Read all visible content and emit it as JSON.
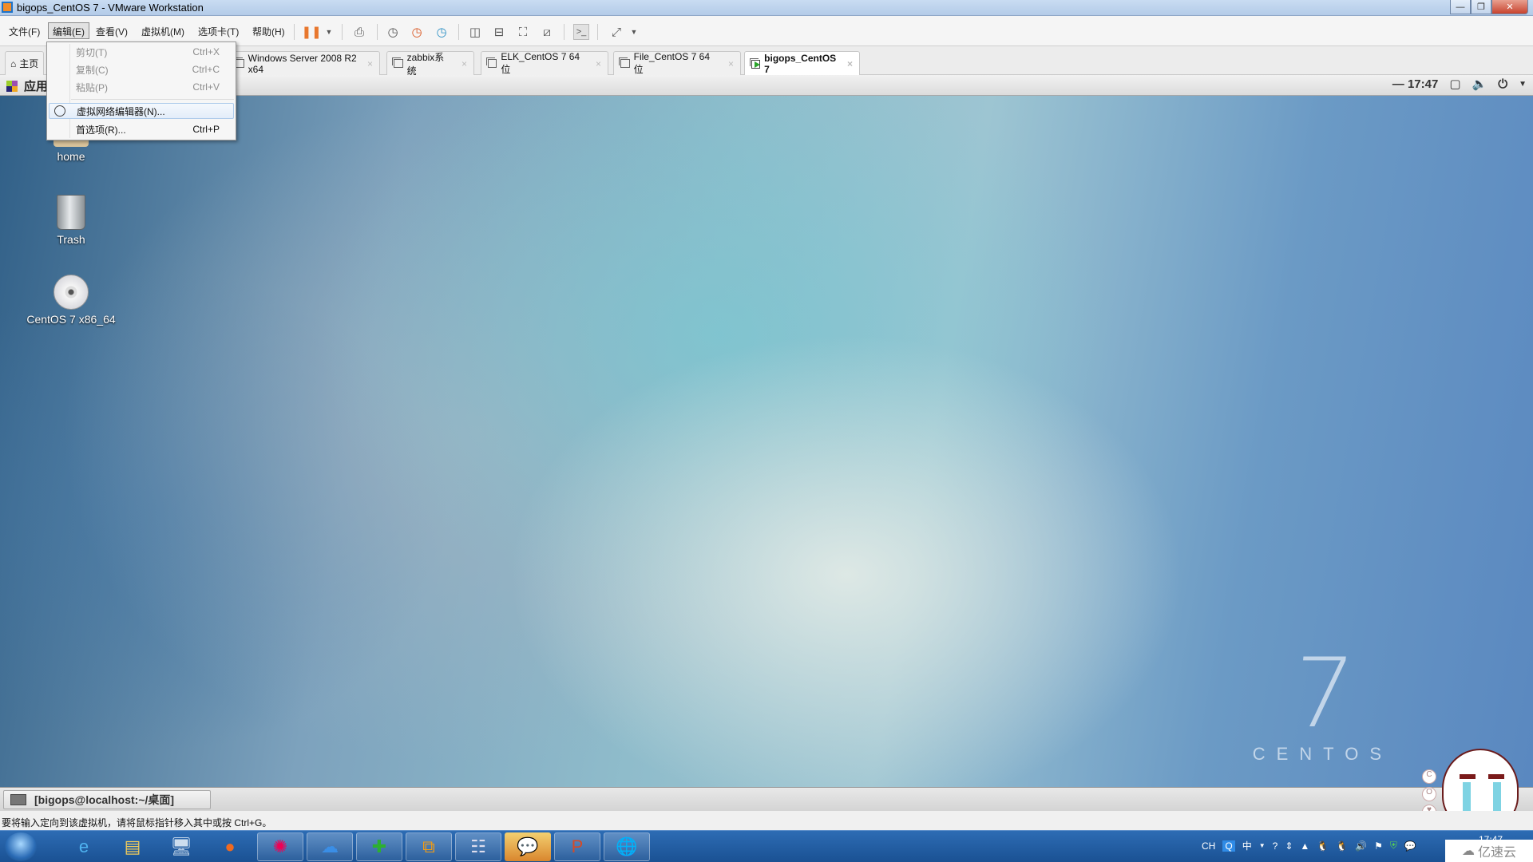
{
  "window": {
    "title": "bigops_CentOS 7 - VMware Workstation",
    "controls": {
      "minimize": "—",
      "restore": "❐",
      "close": "✕"
    }
  },
  "menubar": {
    "items": [
      {
        "label": "文件(F)"
      },
      {
        "label": "编辑(E)",
        "active": true
      },
      {
        "label": "查看(V)"
      },
      {
        "label": "虚拟机(M)"
      },
      {
        "label": "选项卡(T)"
      },
      {
        "label": "帮助(H)"
      }
    ],
    "toolbar_icons": [
      "pause-icon",
      "dropdown-icon",
      "send-ctrl-alt-del-icon",
      "snapshot-take-icon",
      "snapshot-revert-icon",
      "snapshot-manager-icon",
      "view-split-vertical-icon",
      "view-split-horizontal-icon",
      "fullscreen-icon",
      "unity-icon",
      "console-icon",
      "stretch-icon",
      "stretch-dropdown-icon"
    ]
  },
  "edit_menu": {
    "items": [
      {
        "label": "剪切(T)",
        "shortcut": "Ctrl+X",
        "disabled": true
      },
      {
        "label": "复制(C)",
        "shortcut": "Ctrl+C",
        "disabled": true
      },
      {
        "label": "粘贴(P)",
        "shortcut": "Ctrl+V",
        "disabled": true
      },
      {
        "label": "虚拟网络编辑器(N)...",
        "shortcut": "",
        "icon": "network-globe-icon",
        "highlighted": true
      },
      {
        "label": "首选项(R)...",
        "shortcut": "Ctrl+P"
      }
    ]
  },
  "tabs": {
    "home": "主页",
    "items": [
      {
        "label": "Windows Server 2008 R2 x64"
      },
      {
        "label": "zabbix系统"
      },
      {
        "label": "ELK_CentOS 7 64 位"
      },
      {
        "label": "File_CentOS 7 64 位"
      },
      {
        "label": "bigops_CentOS 7",
        "active": true
      }
    ],
    "close_glyph": "×"
  },
  "guest": {
    "top_bar": {
      "apps_label": "应用",
      "clock": "17:47"
    },
    "desktop_icons": [
      {
        "label": "home"
      },
      {
        "label": "Trash"
      },
      {
        "label": "CentOS 7 x86_64"
      }
    ],
    "branding": {
      "number": "7",
      "word": "CENTOS"
    },
    "taskbar_item": "[bigops@localhost:~/桌面]"
  },
  "statusbar": {
    "message": "要将输入定向到该虚拟机，请将鼠标指针移入其中或按 Ctrl+G。"
  },
  "host_taskbar": {
    "pinned": [
      "internet-explorer-icon",
      "file-explorer-icon",
      "remote-desktop-icon",
      "firefox-icon",
      "pinwheel-app-icon",
      "baidu-netdisk-icon",
      "360-security-icon",
      "vmware-icon",
      "control-panel-icon",
      "wechat-icon",
      "powerpoint-icon",
      "network-globe-icon"
    ],
    "tray": {
      "lang": "CH",
      "ime": "中",
      "clock": "17:47"
    },
    "watermark": "亿速云"
  }
}
